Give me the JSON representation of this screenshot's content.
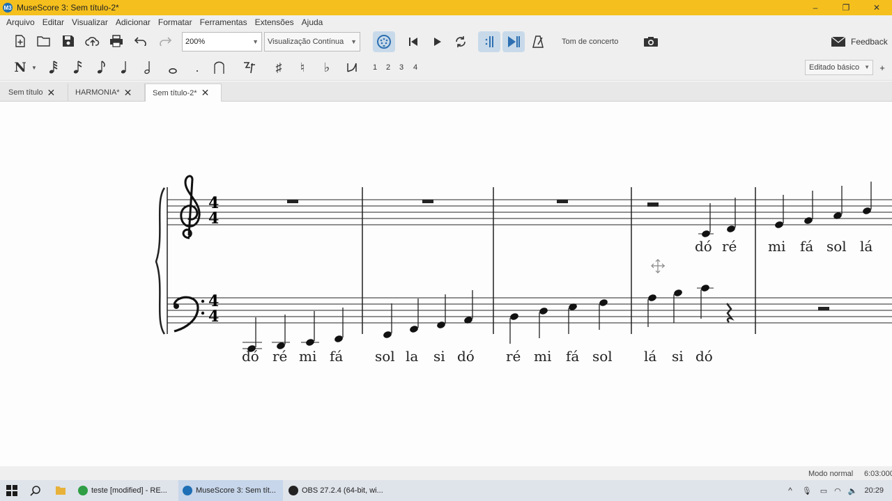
{
  "window": {
    "title": "MuseScore 3: Sem título-2*",
    "app_icon": "M3",
    "min": "–",
    "restore": "❐",
    "close": "✕"
  },
  "menu": [
    "Arquivo",
    "Editar",
    "Visualizar",
    "Adicionar",
    "Formatar",
    "Ferramentas",
    "Extensões",
    "Ajuda"
  ],
  "toolbar": {
    "zoom": "200%",
    "view_mode": "Visualização Contínua",
    "concert_pitch": "Tom de concerto",
    "feedback": "Feedback"
  },
  "note_input": {
    "voices": [
      "1",
      "2",
      "3",
      "4"
    ],
    "workspace": "Editado básico",
    "add_label": "+"
  },
  "tabs": [
    {
      "label": "Sem título",
      "active": false
    },
    {
      "label": "HARMONIA*",
      "active": false
    },
    {
      "label": "Sem título-2*",
      "active": true
    }
  ],
  "score": {
    "time_signature": [
      "4",
      "4"
    ],
    "treble_lyrics": [
      "dó",
      "ré",
      "mi",
      "fá",
      "sol",
      "lá"
    ],
    "bass_lyrics": [
      "dó",
      "ré",
      "mi",
      "fá",
      "sol",
      "la",
      "si",
      "dó",
      "ré",
      "mi",
      "fá",
      "sol",
      "lá",
      "si",
      "dó"
    ]
  },
  "status": {
    "mode": "Modo normal",
    "time": "6:03:000"
  },
  "taskbar": {
    "items": [
      {
        "label": "teste [modified] - RE...",
        "color": "#2f9e44"
      },
      {
        "label": "MuseScore 3: Sem tít...",
        "color": "#1e6fb5"
      },
      {
        "label": "OBS 27.2.4 (64-bit, wi...",
        "color": "#222222"
      }
    ],
    "clock": "20:29"
  }
}
